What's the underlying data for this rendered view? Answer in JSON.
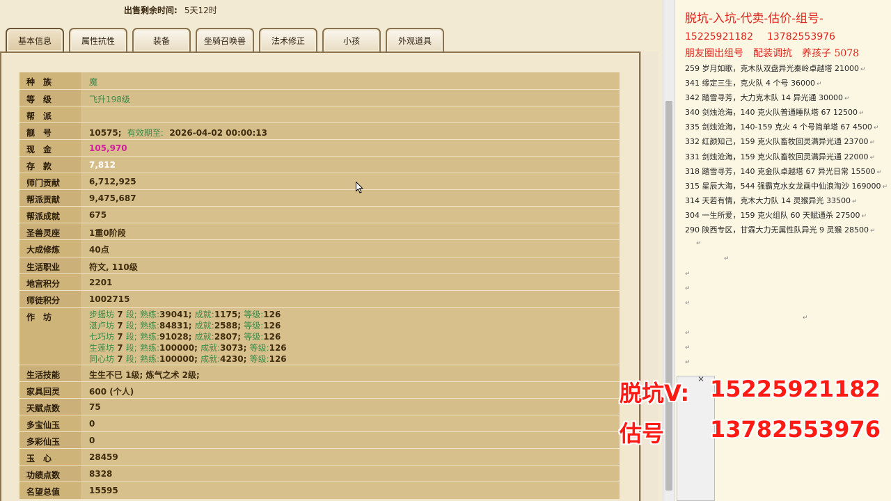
{
  "header": {
    "sale_time_label": "出售剩余时间:",
    "sale_time_value": "5天12时"
  },
  "tabs": [
    {
      "label": "基本信息",
      "active": true
    },
    {
      "label": "属性抗性"
    },
    {
      "label": "装备"
    },
    {
      "label": "坐骑召唤兽"
    },
    {
      "label": "法术修正"
    },
    {
      "label": "小孩"
    },
    {
      "label": "外观道具"
    }
  ],
  "info": {
    "race": {
      "label": "种　族",
      "value": "魔"
    },
    "level": {
      "label": "等　级",
      "value": "飞升198级"
    },
    "faction": {
      "label": "帮　派",
      "value": ""
    },
    "pretty_id": {
      "label": "靓　号",
      "value": "10575;",
      "expire_label": "有效期至:",
      "expire_value": "2026-04-02 00:00:13"
    },
    "cash": {
      "label": "现　金",
      "value": "105,970"
    },
    "deposit": {
      "label": "存　款",
      "value": "7,812"
    },
    "master_contrib": {
      "label": "师门贡献",
      "value": "6,712,925"
    },
    "faction_contrib": {
      "label": "帮派贡献",
      "value": "9,475,687"
    },
    "faction_achieve": {
      "label": "帮派成就",
      "value": "675"
    },
    "beast_seat": {
      "label": "圣兽灵座",
      "value": "1重0阶段"
    },
    "cultivation": {
      "label": "大成修炼",
      "value": "40点"
    },
    "profession": {
      "label": "生活职业",
      "value": "符文, 110级"
    },
    "dungeon_points": {
      "label": "地宫积分",
      "value": "2201"
    },
    "apprentice_points": {
      "label": "师徒积分",
      "value": "1002715"
    },
    "workshop": {
      "label": "作　坊",
      "rows": [
        {
          "name": "步摇坊",
          "stage": "7",
          "proficiency": "39041",
          "achievement": "1175",
          "grade": "126"
        },
        {
          "name": "湛卢坊",
          "stage": "7",
          "proficiency": "84831",
          "achievement": "2588",
          "grade": "126"
        },
        {
          "name": "七巧坊",
          "stage": "7",
          "proficiency": "91028",
          "achievement": "2807",
          "grade": "126"
        },
        {
          "name": "生莲坊",
          "stage": "7",
          "proficiency": "100000",
          "achievement": "3073",
          "grade": "126"
        },
        {
          "name": "同心坊",
          "stage": "7",
          "proficiency": "100000",
          "achievement": "4230",
          "grade": "126"
        }
      ],
      "stage_suffix": "段;",
      "prof_label": "熟练:",
      "ach_label": "成就:",
      "grade_label": "等级:"
    },
    "life_skill": {
      "label": "生活技能",
      "value": "生生不已 1级; 炼气之术 2级;"
    },
    "home_spirit": {
      "label": "家具回灵",
      "value": "600 (个人)"
    },
    "talent_points": {
      "label": "天赋点数",
      "value": "75"
    },
    "multi_treasure_jade": {
      "label": "多宝仙玉",
      "value": "0"
    },
    "multi_color_jade": {
      "label": "多彩仙玉",
      "value": "0"
    },
    "jade_heart": {
      "label": "玉　心",
      "value": "28459"
    },
    "merit_points": {
      "label": "功绩点数",
      "value": "8328"
    },
    "fame_total": {
      "label": "名望总值",
      "value": "15595"
    }
  },
  "notes": {
    "title": "脱坑-入坑-代卖-估价-组号-",
    "phone1": "15225921182",
    "phone2": "13782553976",
    "subtitle": "朋友圈出组号　配装调抗　养孩子 5078",
    "listings": [
      "259 岁月如歌，克木队双盘异光秦岭卓越塔 21000",
      "341 缘定三生，克火队 4 个号 36000",
      "342 踏雪寻芳，大力克木队 14 异光通 30000",
      "340 剑烛沧海，140 克火队普通睡队塔 67  12500",
      "335 剑烛沧海，140-159 克火 4 个号简单塔 67  4500",
      "332 红颜知己，159 克火队畜牧回灵满异光通 23700",
      "331 剑烛沧海，159 克火队畜牧回灵满异光通 22000",
      "318 踏雪寻芳，140 克金队卓越塔 67 异光日常 15500",
      "315 星辰大海，544 强霸克水女龙画中仙浪淘沙 169000",
      "314 天若有情，克木大力队 14 灵猴异光 33500",
      "304 一生所爱，159 克火组队 60 天赋通杀 27500",
      "290 陕西专区，甘霖大力无属性队异光 9 灵猴 28500"
    ]
  },
  "overlay": {
    "line1_label": "脱坑V:",
    "line1_value": "15225921182",
    "line2_label": "估号",
    "line2_value": "13782553976"
  },
  "colors": {
    "label_bg": "#cfb47a",
    "value_bg": "#d8c08c",
    "green_text": "#3d8a4a",
    "cash_pink": "#d3209f",
    "red_text": "#e0241d"
  }
}
